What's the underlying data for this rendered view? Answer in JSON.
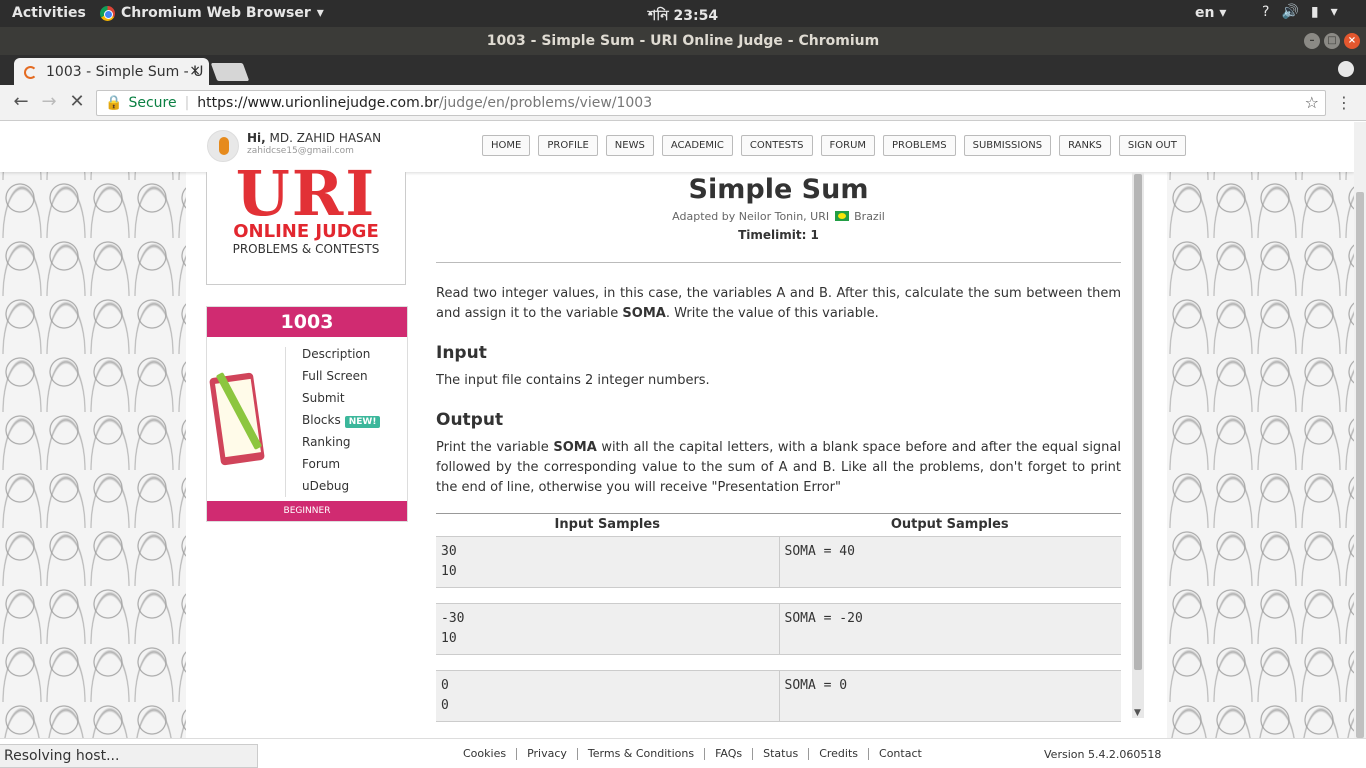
{
  "system_bar": {
    "activities": "Activities",
    "app_name": "Chromium Web Browser",
    "clock": "শনি 23:54",
    "lang": "en"
  },
  "window": {
    "title": "1003 - Simple Sum - URI Online Judge - Chromium"
  },
  "tab": {
    "label": "1003 - Simple Sum - U"
  },
  "address": {
    "secure": "Secure",
    "host": "https://www.urionlinejudge.com.br",
    "path": "/judge/en/problems/view/1003"
  },
  "user": {
    "greeting": "Hi,",
    "name": "MD. ZAHID HASAN",
    "email": "zahidcse15@gmail.com"
  },
  "nav": [
    "HOME",
    "PROFILE",
    "NEWS",
    "ACADEMIC",
    "CONTESTS",
    "FORUM",
    "PROBLEMS",
    "SUBMISSIONS",
    "RANKS",
    "SIGN OUT"
  ],
  "logo": {
    "uri": "URI",
    "line1": "ONLINE JUDGE",
    "line2": "PROBLEMS & CONTESTS"
  },
  "problem_box": {
    "number": "1003",
    "links": [
      "Description",
      "Full Screen",
      "Submit",
      "Blocks",
      "Ranking",
      "Forum",
      "uDebug"
    ],
    "new_badge": "NEW!",
    "level": "BEGINNER"
  },
  "problem": {
    "title": "Simple Sum",
    "adapted": "Adapted by Neilor Tonin, URI",
    "country": "Brazil",
    "timelimit": "Timelimit: 1",
    "intro_a": "Read two integer values, in this case, the variables A and B. After this, calculate the sum between them and assign it to the variable ",
    "intro_bold": "SOMA",
    "intro_b": ". Write the value of this variable.",
    "input_heading": "Input",
    "input_text": "The input file contains 2 integer numbers.",
    "output_heading": "Output",
    "output_a": "Print the variable ",
    "output_bold": "SOMA",
    "output_b": " with all the capital letters, with a blank space before and after the equal signal followed by the corresponding value to the sum of A and B. Like all the problems, don't forget to print the end of line, otherwise you will receive \"Presentation Error\""
  },
  "samples": {
    "input_header": "Input Samples",
    "output_header": "Output Samples",
    "rows": [
      {
        "input": "30\n10",
        "output": "SOMA = 40"
      },
      {
        "input": "-30\n10",
        "output": "SOMA = -20"
      },
      {
        "input": "0\n0",
        "output": "SOMA = 0"
      }
    ]
  },
  "footer": {
    "links": [
      "Cookies",
      "Privacy",
      "Terms & Conditions",
      "FAQs",
      "Status",
      "Credits",
      "Contact"
    ],
    "version": "Version 5.4.2.060518"
  },
  "status_bar": "Resolving host..."
}
